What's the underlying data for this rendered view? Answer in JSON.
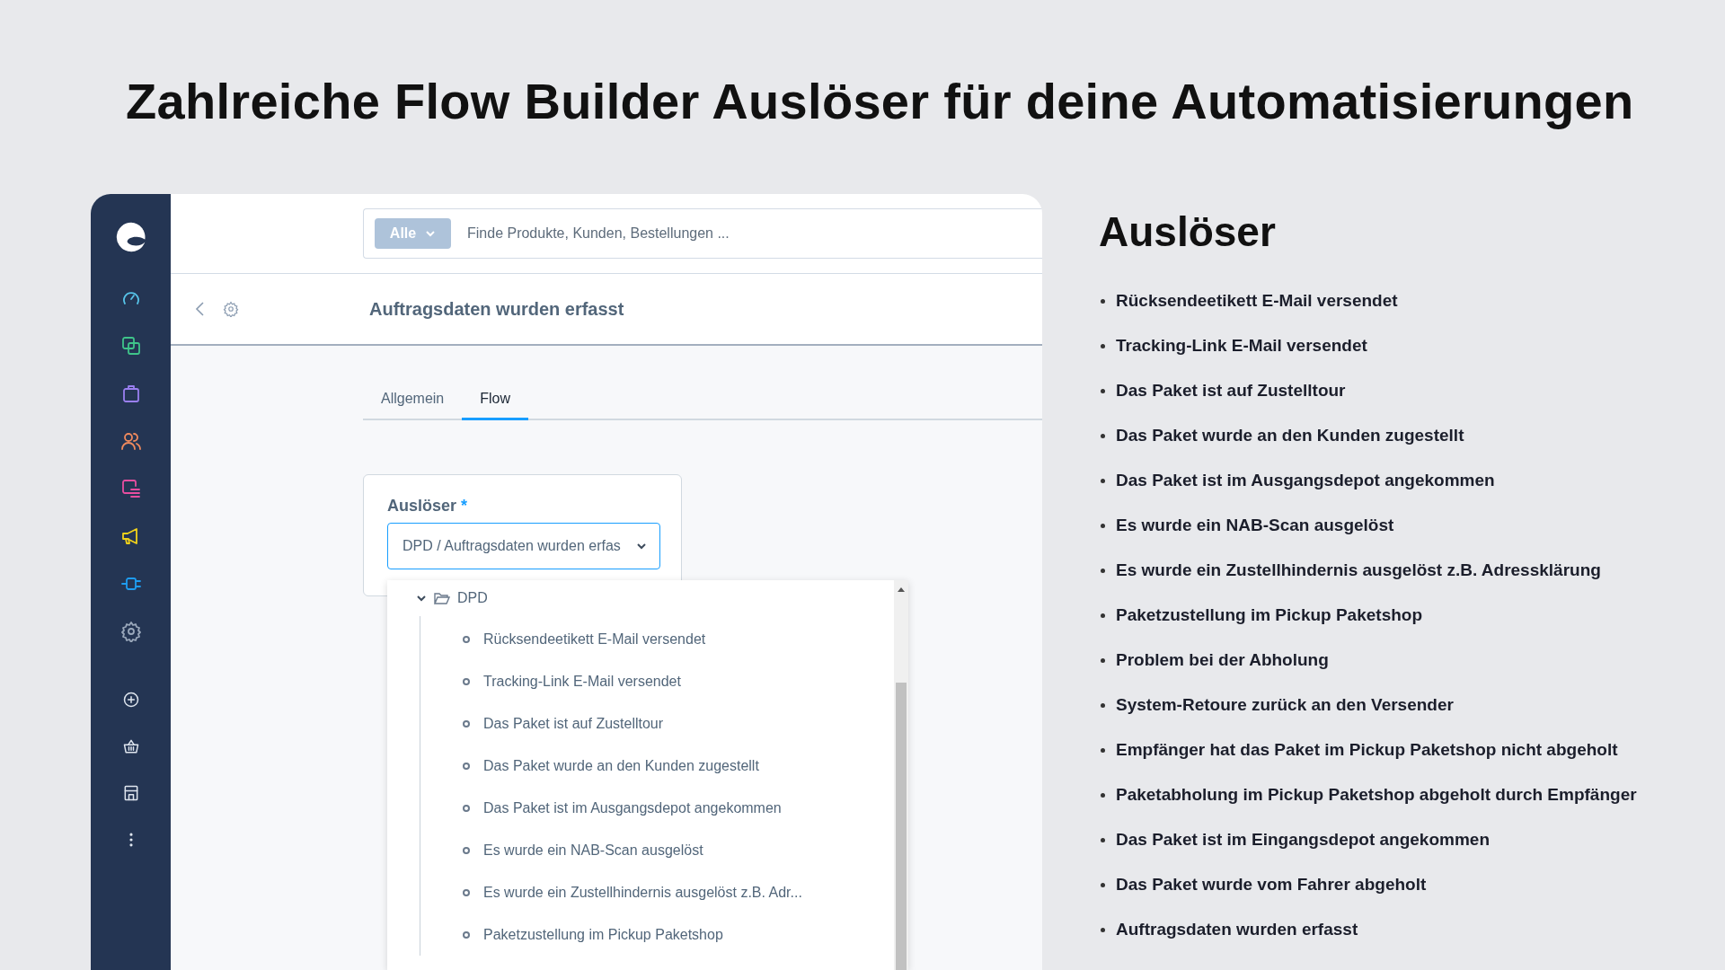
{
  "headline": "Zahlreiche Flow Builder Auslöser für deine Automatisierungen",
  "app": {
    "search": {
      "scope": "Alle",
      "placeholder": "Finde Produkte, Kunden, Bestellungen ..."
    },
    "page_title": "Auftragsdaten wurden erfasst",
    "tabs": [
      {
        "label": "Allgemein",
        "selected": false
      },
      {
        "label": "Flow",
        "selected": true
      }
    ],
    "trigger_field": {
      "label": "Auslöser",
      "required_mark": "*",
      "value": "DPD / Auftragsdaten wurden erfas"
    },
    "tree": [
      {
        "label": "DPD",
        "expanded": true,
        "children": [
          {
            "label": "Rücksendeetikett E-Mail versendet"
          },
          {
            "label": "Tracking-Link E-Mail versendet"
          },
          {
            "label": "Das Paket ist auf Zustelltour"
          },
          {
            "label": "Das Paket wurde an den Kunden zugestellt"
          },
          {
            "label": "Das Paket ist im Ausgangsdepot angekommen"
          },
          {
            "label": "Es wurde ein NAB-Scan ausgelöst"
          },
          {
            "label": "Es wurde ein Zustellhindernis ausgelöst z.B. Adr..."
          },
          {
            "label": "Paketzustellung im Pickup Paketshop"
          }
        ]
      }
    ]
  },
  "panel": {
    "title": "Auslöser",
    "items": [
      "Rücksendeetikett E-Mail versendet",
      "Tracking-Link E-Mail versendet",
      "Das Paket ist auf Zustelltour",
      "Das Paket wurde an den Kunden zugestellt",
      "Das Paket ist im Ausgangsdepot angekommen",
      "Es wurde ein NAB-Scan ausgelöst",
      "Es wurde ein Zustellhindernis ausgelöst z.B. Adressklärung",
      "Paketzustellung im Pickup Paketshop",
      "Problem bei der Abholung",
      "System-Retoure zurück an den Versender",
      "Empfänger hat das Paket im Pickup Paketshop nicht abgeholt",
      "Paketabholung im Pickup Paketshop abgeholt durch Empfänger",
      "Das Paket ist im Eingangsdepot angekommen",
      "Das Paket wurde vom Fahrer abgeholt",
      "Auftragsdaten wurden erfasst"
    ]
  }
}
